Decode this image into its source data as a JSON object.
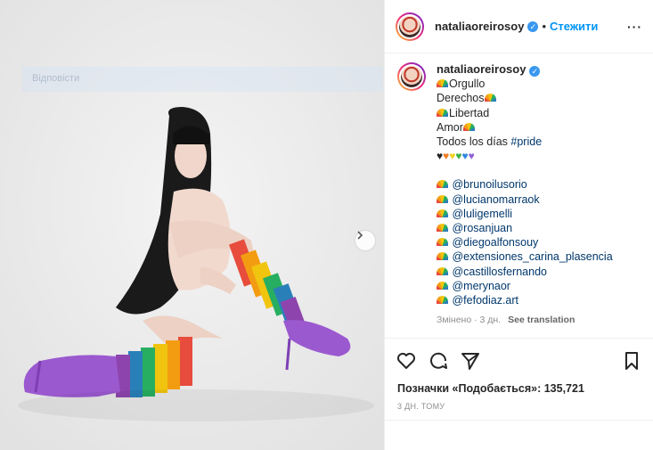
{
  "post": {
    "username": "nataliaoreirosoy",
    "follow_label": "Стежити",
    "caption_lines": [
      "Orgullo",
      "Derechos",
      "Libertad",
      "Amor",
      "Todos los días"
    ],
    "hashtag": "#pride",
    "heart_colors": [
      "#222222",
      "#f07a22",
      "#f5d21f",
      "#3cb043",
      "#2e86de",
      "#8e63d6"
    ],
    "mentions": [
      "@brunoilusorio",
      "@lucianomarraok",
      "@luligemelli",
      "@rosanjuan",
      "@diegoalfonsouy",
      "@extensiones_carina_plasencia",
      "@castillosfernando",
      "@merynaor",
      "@fefodiaz.art"
    ],
    "edited_text": "Змінено · 3 дн.",
    "translate_label": "See translation",
    "likes_text": "Позначки «Подобається»: 135,721",
    "date_text": "3 ДН. ТОМУ"
  },
  "image": {
    "ghost_label": "Відповісти"
  }
}
